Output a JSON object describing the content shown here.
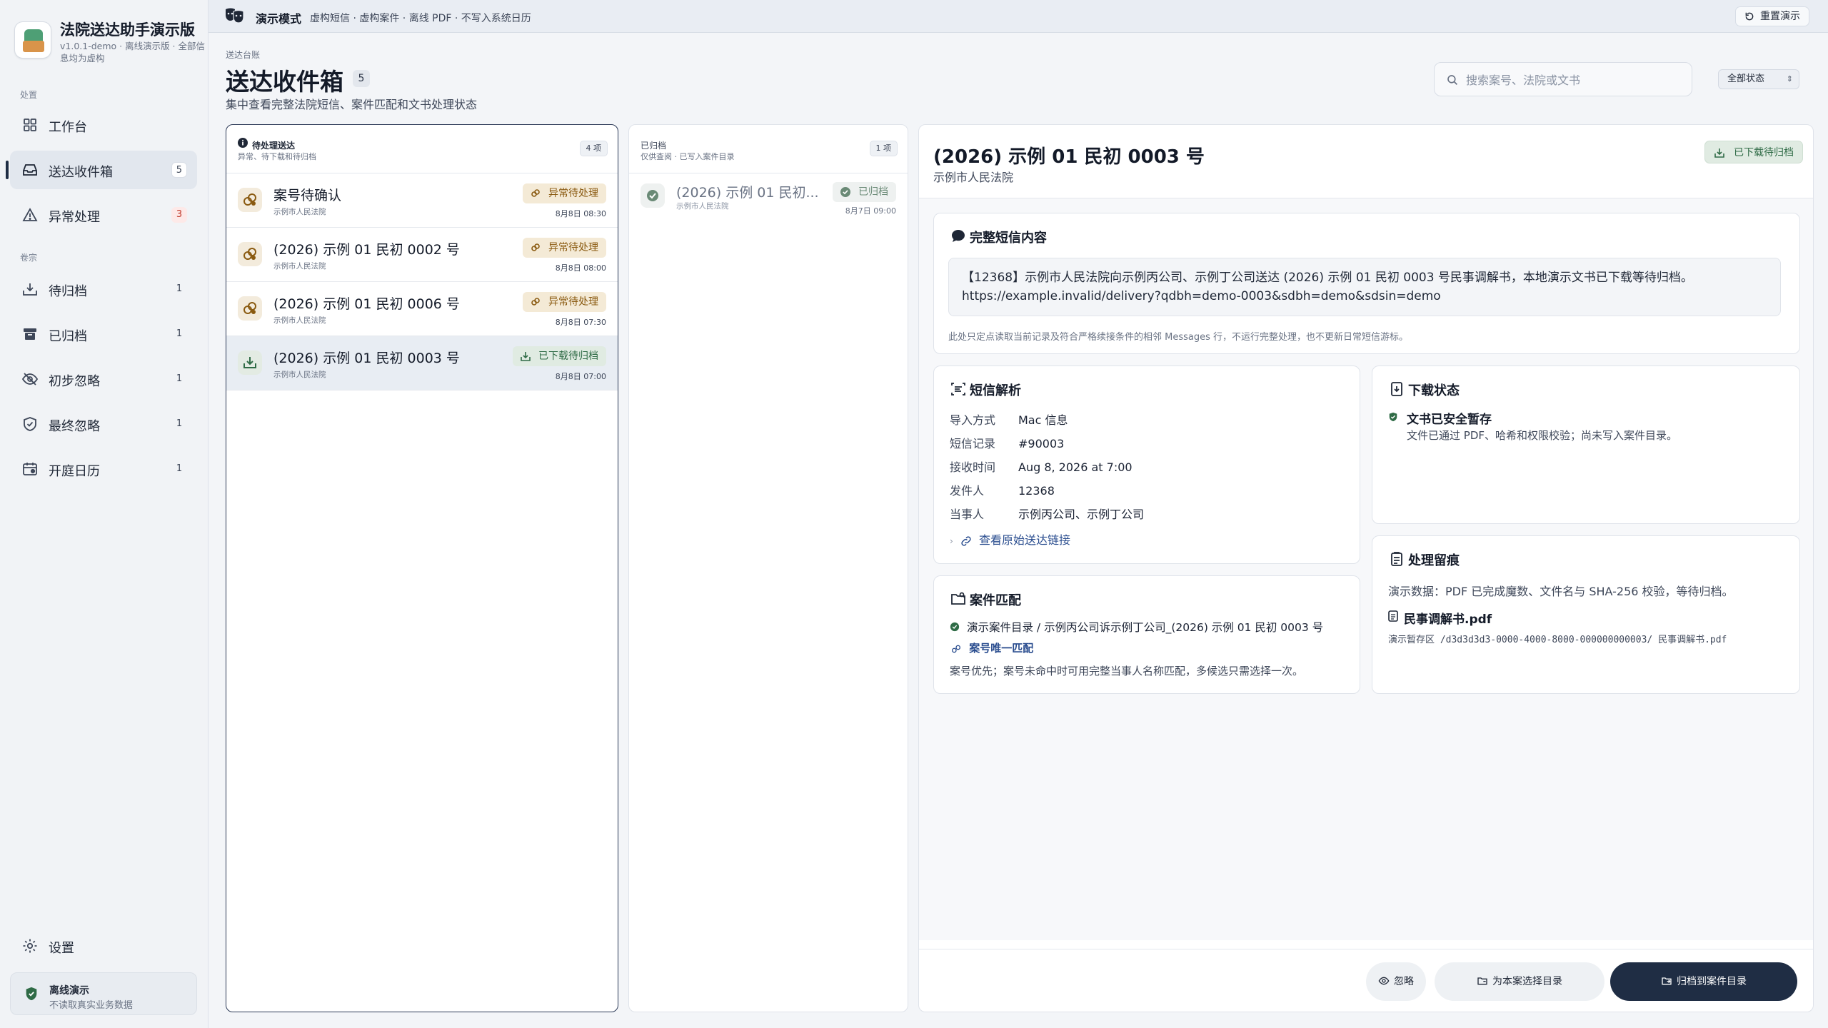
{
  "app": {
    "title": "法院送达助手演示版",
    "subtitle": "v1.0.1-demo · 离线演示版 · 全部信息均为虚构"
  },
  "topbar": {
    "mode": "演示模式",
    "mode_desc": "虚构短信 · 虚构案件 · 离线 PDF · 不写入系统日历",
    "reset_label": "重置演示"
  },
  "sidebar": {
    "group_process": "处置",
    "group_files": "卷宗",
    "items": [
      {
        "label": "工作台",
        "count": ""
      },
      {
        "label": "送达收件箱",
        "count": "5"
      },
      {
        "label": "异常处理",
        "count": "3"
      },
      {
        "label": "待归档",
        "count": "1"
      },
      {
        "label": "已归档",
        "count": "1"
      },
      {
        "label": "初步忽略",
        "count": "1"
      },
      {
        "label": "最终忽略",
        "count": "1"
      },
      {
        "label": "开庭日历",
        "count": "1"
      }
    ],
    "settings_label": "设置",
    "offline_title": "离线演示",
    "offline_desc": "不读取真实业务数据"
  },
  "header": {
    "crumb": "送达台账",
    "title": "送达收件箱",
    "count": "5",
    "subtitle": "集中查看完整法院短信、案件匹配和文书处理状态",
    "search_placeholder": "搜索案号、法院或文书",
    "status_filter": "全部状态"
  },
  "pending": {
    "title": "待处理送达",
    "desc": "异常、待下载和待归档",
    "count": "4 项",
    "rows": [
      {
        "title": "案号待确认",
        "court": "示例市人民法院",
        "badge": "异常待处理",
        "time": "8月8日 08:30"
      },
      {
        "title": "(2026) 示例 01 民初 0002 号",
        "court": "示例市人民法院",
        "badge": "异常待处理",
        "time": "8月8日 08:00"
      },
      {
        "title": "(2026) 示例 01 民初 0006 号",
        "court": "示例市人民法院",
        "badge": "异常待处理",
        "time": "8月8日 07:30"
      },
      {
        "title": "(2026) 示例 01 民初 0003 号",
        "court": "示例市人民法院",
        "badge": "已下载待归档",
        "time": "8月8日 07:00"
      }
    ]
  },
  "archived": {
    "title": "已归档",
    "desc": "仅供查阅 · 已写入案件目录",
    "count": "1 项",
    "rows": [
      {
        "title": "(2026) 示例 01 民初...",
        "court": "示例市人民法院",
        "badge": "已归档",
        "time": "8月7日 09:00"
      }
    ]
  },
  "detail": {
    "title": "(2026) 示例 01 民初 0003 号",
    "court": "示例市人民法院",
    "badge": "已下载待归档",
    "sms": {
      "title": "完整短信内容",
      "content": "【12368】示例市人民法院向示例丙公司、示例丁公司送达 (2026) 示例 01 民初 0003 号民事调解书，本地演示文书已下载等待归档。https://example.invalid/delivery?qdbh=demo-0003&sdbh=demo&sdsin=demo",
      "note": "此处只定点读取当前记录及符合严格续接条件的相邻 Messages 行，不运行完整处理，也不更新日常短信游标。"
    },
    "parse": {
      "title": "短信解析",
      "fields": [
        {
          "k": "导入方式",
          "v": "Mac 信息"
        },
        {
          "k": "短信记录",
          "v": "#90003"
        },
        {
          "k": "接收时间",
          "v": "Aug 8, 2026 at 7:00"
        },
        {
          "k": "发件人",
          "v": "12368"
        },
        {
          "k": "当事人",
          "v": "示例丙公司、示例丁公司"
        }
      ],
      "link": "查看原始送达链接"
    },
    "download": {
      "title": "下载状态",
      "status": "文书已安全暂存",
      "desc": "文件已通过 PDF、哈希和权限校验；尚未写入案件目录。"
    },
    "match": {
      "title": "案件匹配",
      "path": "演示案件目录 / 示例丙公司诉示例丁公司_(2026) 示例 01 民初 0003 号",
      "unique": "案号唯一匹配",
      "desc": "案号优先；案号未命中时可用完整当事人名称匹配，多候选只需选择一次。"
    },
    "trace": {
      "title": "处理留痕",
      "desc": "演示数据：PDF 已完成魔数、文件名与 SHA-256 校验，等待归档。",
      "file": "民事调解书.pdf",
      "path": "演示暂存区 /d3d3d3d3-0000-4000-8000-000000000003/ 民事调解书.pdf"
    },
    "actions": {
      "ignore": "忽略",
      "choose": "为本案选择目录",
      "archive": "归档到案件目录"
    }
  },
  "colors": {
    "primary": "#1f2d44",
    "warning_bg": "#f4ead6",
    "warning_fg": "#8a5a10",
    "success_bg": "#e0ebe2",
    "success_fg": "#2f6b46",
    "danger": "#c0392b"
  }
}
